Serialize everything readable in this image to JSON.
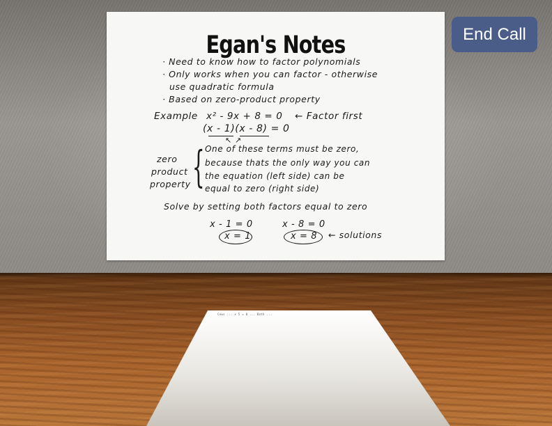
{
  "whiteboard": {
    "title": "Egan's Notes",
    "bullets": [
      "· Need to know how to factor polynomials",
      "· Only works when you can factor - otherwise",
      "use quadratic formula",
      "· Based on zero-product property"
    ],
    "example_label": "Example",
    "equation": "x² - 9x + 8 = 0",
    "factor_note": "← Factor first",
    "factored": "(x - 1)(x - 8) = 0",
    "arrows": "↖       ↗",
    "zero_label": "zero",
    "product_label": "product",
    "property_label": "property",
    "explanation": [
      "One of these terms must be zero,",
      "because thats the only way you can",
      "the equation (left side) can be",
      "equal to zero (right side)"
    ],
    "solve_line": "Solve by setting both factors equal to zero",
    "eq1": "x - 1 = 0",
    "eq2": "x - 8 = 0",
    "sol1": "x = 1",
    "sol2": "x = 8",
    "solutions_note": "← solutions"
  },
  "controls": {
    "end_call_label": "End Call"
  },
  "paper": {
    "tiny_text": "Cows ... x 5 = 0 ... Both ..."
  }
}
